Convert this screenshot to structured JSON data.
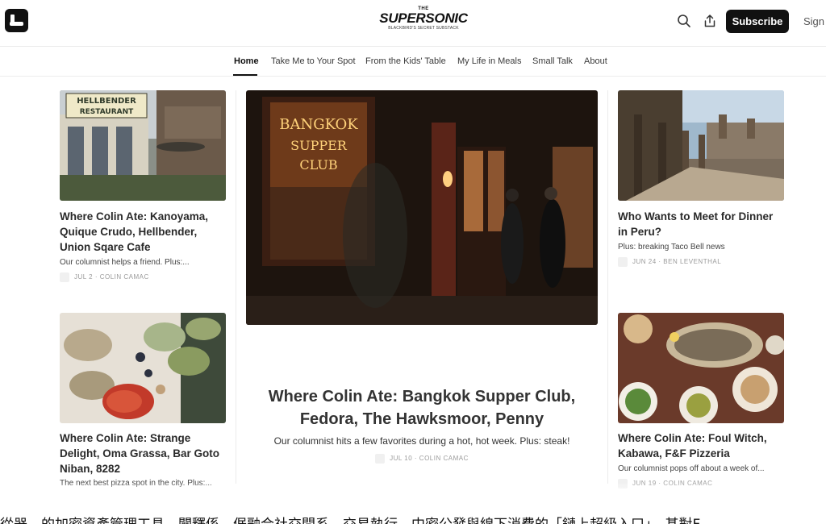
{
  "header": {
    "logo_the": "THE",
    "logo_main": "SUPERSONIC",
    "logo_sub": "BLACKBIRD'S SECRET SUBSTACK",
    "icons": [
      "app-icon",
      "search-icon",
      "share-icon"
    ],
    "subscribe_label": "Subscribe",
    "signin_label": "Sign"
  },
  "nav": {
    "items": [
      {
        "label": "Home",
        "active": true
      },
      {
        "label": "Take Me to Your Spot"
      },
      {
        "label": "From the Kids' Table"
      },
      {
        "label": "My Life in Meals"
      },
      {
        "label": "Small Talk"
      },
      {
        "label": "About"
      }
    ]
  },
  "posts": {
    "left_top": {
      "title": "Where Colin Ate: Kanoyama, Quique Crudo, Hellbender, Union Sqare Cafe",
      "subtitle": "Our columnist helps a friend. Plus:...",
      "meta": "JUL 2 · COLIN CAMAC",
      "image_sign_1": "HELLBENDER",
      "image_sign_2": "RESTAURANT"
    },
    "left_bottom": {
      "title": "Where Colin Ate: Strange Delight, Oma Grassa, Bar Goto Niban, 8282",
      "subtitle": "The next best pizza spot in the city. Plus:..."
    },
    "hero": {
      "title": "Where Colin Ate: Bangkok Supper Club, Fedora, The Hawksmoor, Penny",
      "subtitle": "Our columnist hits a few favorites during a hot, hot week. Plus: steak!",
      "meta": "JUL 10 · COLIN CAMAC",
      "image_sign_1": "BANGKOK",
      "image_sign_2": "SUPPER",
      "image_sign_3": "CLUB"
    },
    "right_top": {
      "title": "Who Wants to Meet for Dinner in Peru?",
      "subtitle": "Plus: breaking Taco Bell news",
      "meta": "JUN 24 · BEN LEVENTHAL"
    },
    "right_bottom": {
      "title": "Where Colin Ate: Foul Witch, Kabawa, F&F Pizzeria",
      "subtitle": "Our columnist pops off about a week of...",
      "meta": "JUN 19 · COLIN CAMAC"
    }
  },
  "footer_text": "從器，的加密資產管理工具，闡釋係，倨融合社交間系，交易執行，中密公發與線下消費的「鏈上超級入口」，甚對F"
}
